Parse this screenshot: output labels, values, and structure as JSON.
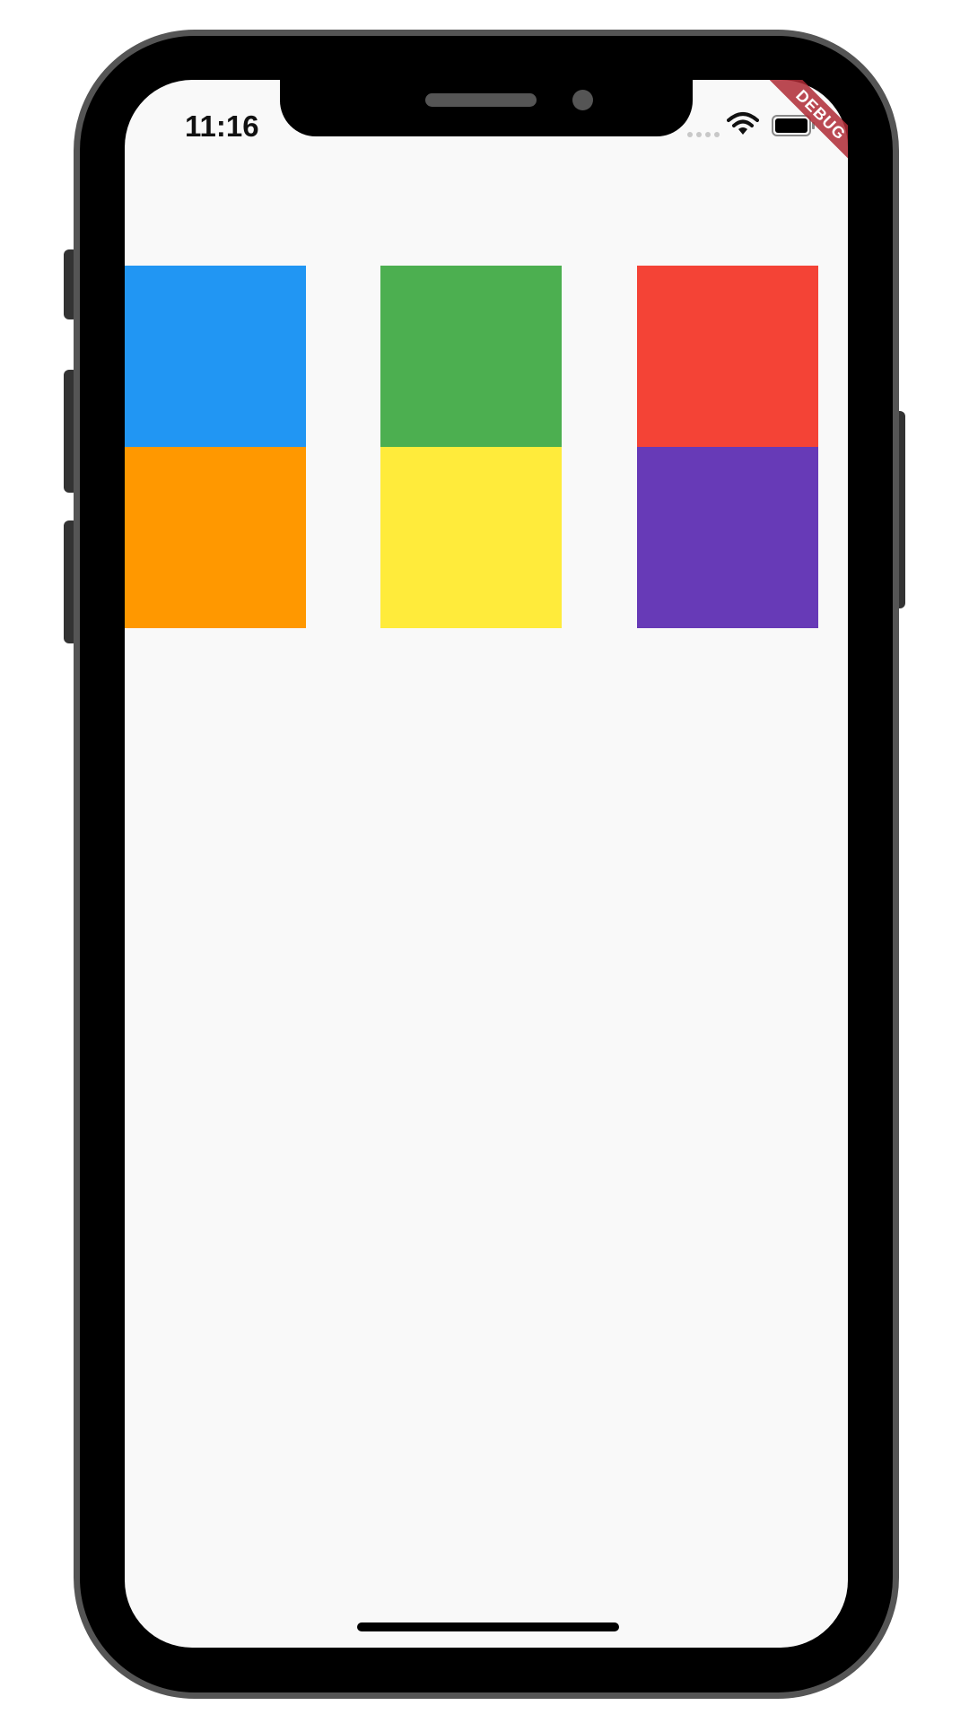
{
  "status_bar": {
    "time": "11:16",
    "signal_icon": "cellular-signal-icon",
    "wifi_icon": "wifi-icon",
    "battery_icon": "battery-icon"
  },
  "debug_banner": {
    "label": "DEBUG",
    "color": "#b02b35"
  },
  "tiles": [
    {
      "name": "blue",
      "color": "#2196f3"
    },
    {
      "name": "green",
      "color": "#4caf50"
    },
    {
      "name": "red",
      "color": "#f44336"
    },
    {
      "name": "orange",
      "color": "#ff9800"
    },
    {
      "name": "yellow",
      "color": "#ffeb3b"
    },
    {
      "name": "purple",
      "color": "#673ab7"
    }
  ],
  "device": {
    "frame_color": "#000000",
    "bezel_color": "#555555",
    "screen_background": "#f9f9f9"
  }
}
